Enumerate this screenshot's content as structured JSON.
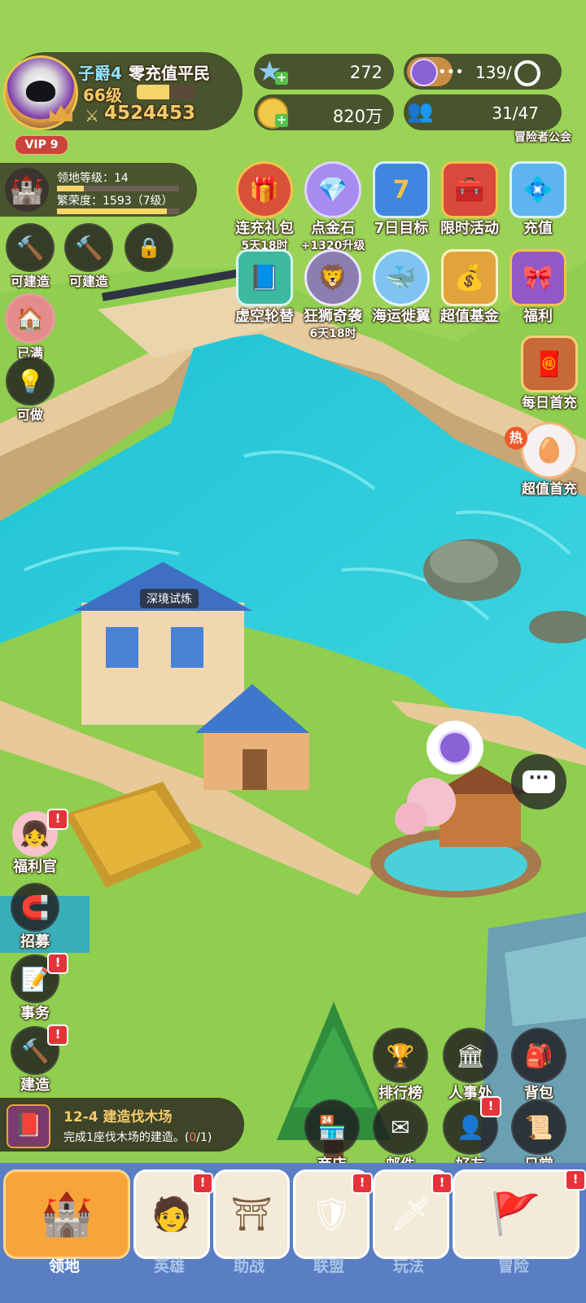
{
  "player": {
    "rank": "子爵4",
    "title": "零充值平民",
    "level": "66级",
    "power": "4524453",
    "vip": "VIP 9",
    "level_progress": 0.55
  },
  "resources": {
    "star_gems": "272",
    "coins": "820万",
    "stamina": "139/",
    "members": "31/47",
    "guild_label": "冒险者公会"
  },
  "territory": {
    "level_text": "领地等级：14",
    "prosperity_text": "繁荣度：1593（7级）",
    "level_progress": 0.22,
    "prosperity_progress": 0.9
  },
  "left_actions": [
    {
      "label": "可建造",
      "icon": "hammer-icon"
    },
    {
      "label": "可建造",
      "icon": "hammer-icon"
    },
    {
      "label": "",
      "icon": "lock-icon"
    },
    {
      "label": "已满",
      "icon": "house-icon"
    },
    {
      "label": "可做",
      "icon": "lightbulb-icon"
    }
  ],
  "event_icons_row1": [
    {
      "label": "连充礼包",
      "sub": "5天18时",
      "icon": "gift-chest-icon"
    },
    {
      "label": "点金石",
      "sub": "+1320升级",
      "icon": "crystal-icon"
    },
    {
      "label": "7日目标",
      "sub": "",
      "icon": "calendar-icon",
      "day": "7"
    },
    {
      "label": "限时活动",
      "sub": "",
      "icon": "event-chest-icon"
    },
    {
      "label": "充值",
      "sub": "",
      "icon": "diamond-box-icon"
    }
  ],
  "event_icons_row2": [
    {
      "label": "虚空轮替",
      "sub": "",
      "icon": "void-book-icon"
    },
    {
      "label": "狂狮奇袭",
      "sub": "6天18时",
      "icon": "lion-icon"
    },
    {
      "label": "海运徙翼",
      "sub": "",
      "icon": "sea-creature-icon"
    },
    {
      "label": "超值基金",
      "sub": "",
      "icon": "treasure-chest-icon"
    },
    {
      "label": "福利",
      "sub": "",
      "icon": "welfare-box-icon"
    }
  ],
  "right_side": [
    {
      "label": "每日首充",
      "icon": "daily-chest-icon"
    },
    {
      "label": "超值首充",
      "icon": "hot-egg-icon",
      "tag": "热"
    }
  ],
  "map_labels": {
    "trial_building": "深境试炼"
  },
  "bottom_left_actions": [
    {
      "label": "福利官",
      "icon": "welfare-officer-icon"
    },
    {
      "label": "招募",
      "icon": "recruit-icon"
    },
    {
      "label": "事务",
      "icon": "affairs-icon"
    },
    {
      "label": "建造",
      "icon": "build-hammer-icon"
    }
  ],
  "bottom_right_row1": [
    {
      "label": "排行榜",
      "icon": "trophy-icon"
    },
    {
      "label": "人事处",
      "icon": "hall-icon"
    },
    {
      "label": "背包",
      "icon": "backpack-icon"
    }
  ],
  "bottom_right_row2": [
    {
      "label": "商店",
      "icon": "shop-icon"
    },
    {
      "label": "邮件",
      "icon": "mail-icon"
    },
    {
      "label": "好友",
      "icon": "friends-icon"
    },
    {
      "label": "日常",
      "icon": "scroll-icon"
    }
  ],
  "quest": {
    "title": "12-4 建造伐木场",
    "desc_prefix": "完成1座伐木场的建造。(",
    "desc_count": "0",
    "desc_suffix": "/1)"
  },
  "bottom_nav": [
    {
      "label": "领地",
      "icon": "castle-icon",
      "active": true
    },
    {
      "label": "英雄",
      "icon": "hero-icon",
      "active": false
    },
    {
      "label": "助战",
      "icon": "assist-icon",
      "active": false
    },
    {
      "label": "联盟",
      "icon": "alliance-banner-icon",
      "active": false
    },
    {
      "label": "玩法",
      "icon": "gameplay-gate-icon",
      "active": false
    },
    {
      "label": "冒险",
      "icon": "adventure-flag-icon",
      "active": false
    }
  ],
  "colors": {
    "grass": "#8fce4e",
    "water": "#2ec9d8",
    "path": "#e7c99a",
    "nav_bg": "#5a7ec4",
    "nav_active": "#f7a53a",
    "badge": "#e5333a",
    "accent_gold": "#f5d56a"
  }
}
